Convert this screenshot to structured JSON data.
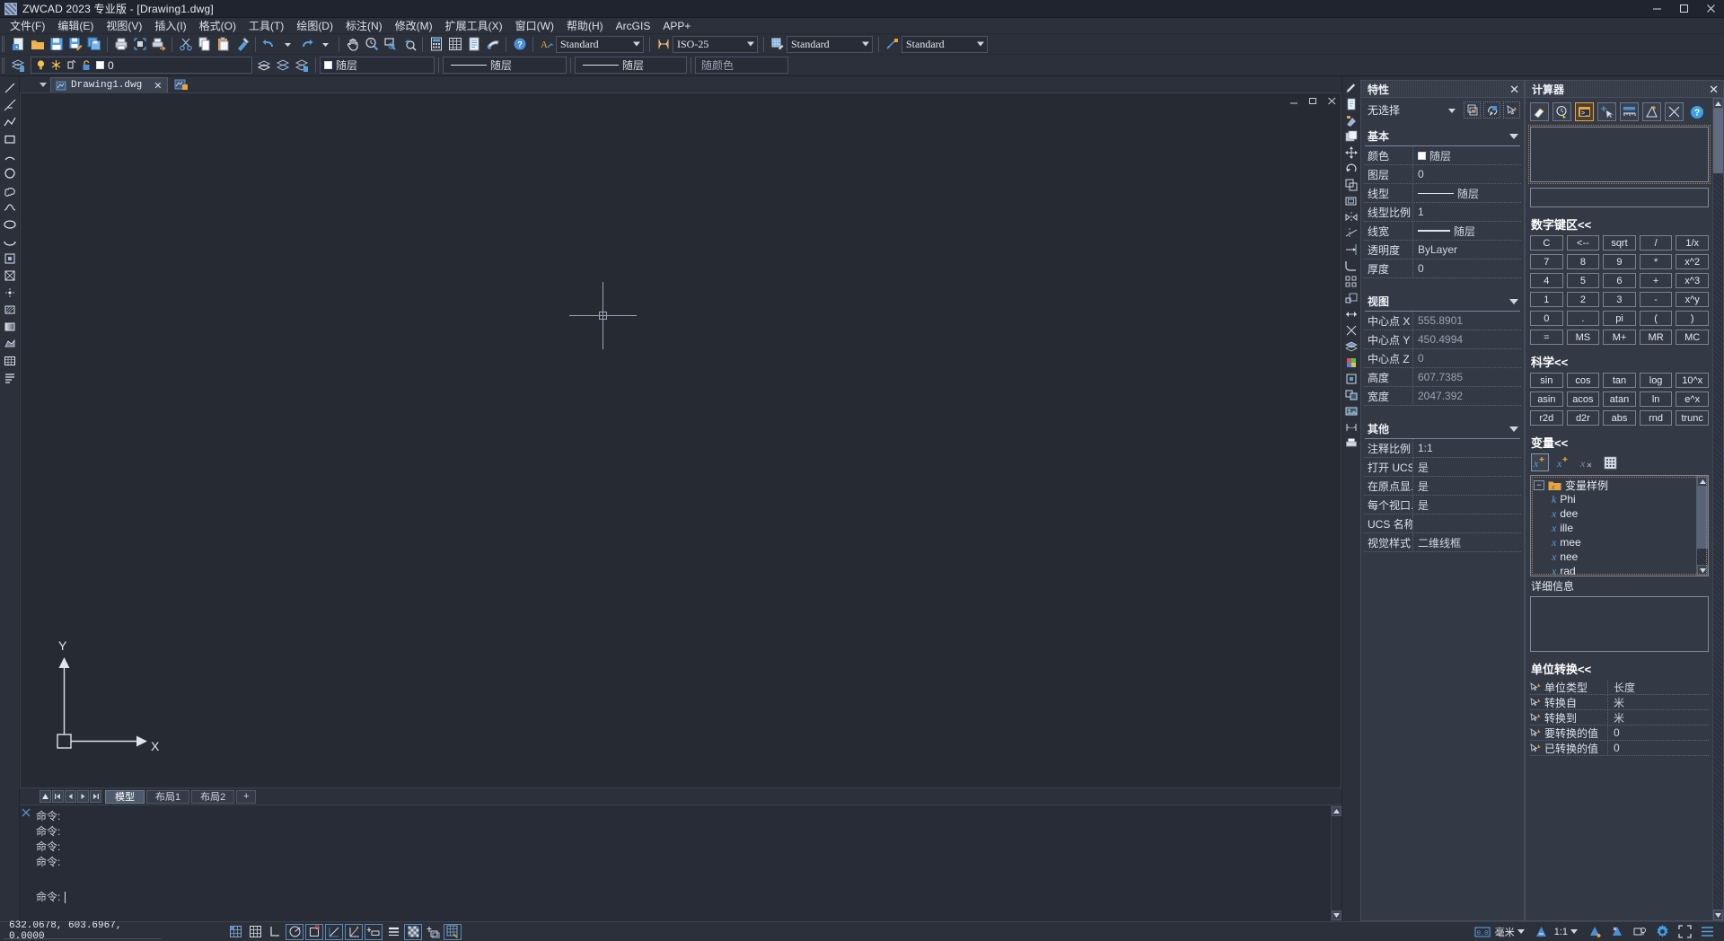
{
  "window": {
    "title": "ZWCAD 2023 专业版 - [Drawing1.dwg]",
    "minimize": "–",
    "maximize": "❐",
    "close": "✕"
  },
  "menu": {
    "items": [
      {
        "label": "文件(F)"
      },
      {
        "label": "编辑(E)"
      },
      {
        "label": "视图(V)"
      },
      {
        "label": "插入(I)"
      },
      {
        "label": "格式(O)"
      },
      {
        "label": "工具(T)"
      },
      {
        "label": "绘图(D)"
      },
      {
        "label": "标注(N)"
      },
      {
        "label": "修改(M)"
      },
      {
        "label": "扩展工具(X)"
      },
      {
        "label": "窗口(W)"
      },
      {
        "label": "帮助(H)"
      },
      {
        "label": "ArcGIS"
      },
      {
        "label": "APP+"
      }
    ]
  },
  "toolbar1": {
    "icons": [
      "new-file-icon",
      "open-folder-icon",
      "save-icon",
      "save-as-icon",
      "save-all-icon",
      "plot-icon",
      "plot-preview-icon",
      "publish-icon",
      "cut-icon",
      "copy-icon",
      "paste-icon",
      "match-properties-icon",
      "undo-icon",
      "undo-dropdown-icon",
      "redo-icon",
      "redo-dropdown-icon",
      "pan-icon",
      "zoom-realtime-icon",
      "zoom-window-icon",
      "zoom-previous-icon",
      "calculator-icon",
      "table-icon",
      "properties-icon",
      "design-center-icon",
      "help-icon"
    ],
    "style_combo": {
      "value": "Standard",
      "icon": "text-style-icon"
    },
    "dim_combo": {
      "value": "ISO-25",
      "icon": "dimension-style-icon"
    },
    "table_combo": {
      "value": "Standard",
      "icon": "table-style-icon"
    },
    "mleader_combo": {
      "value": "Standard",
      "icon": "multileader-style-icon"
    }
  },
  "toolbar2": {
    "layer_manager_icon": "layer-manager-icon",
    "layer": {
      "name": "0",
      "icons": [
        "layer-on-icon",
        "layer-freeze-icon",
        "layer-lock-ploticon",
        "layer-unlock-icon",
        "layer-color-swatch"
      ]
    },
    "layer_tools": [
      "make-object-layer-current-icon",
      "layer-previous-icon",
      "layer-states-icon"
    ],
    "color_combo": {
      "value": "随层"
    },
    "linetype_combo": {
      "value": "随层"
    },
    "lineweight_combo": {
      "value": "随层"
    },
    "plotstyle_combo": {
      "value": "随颜色"
    }
  },
  "left_toolbar": {
    "icons": [
      "line-icon",
      "construction-line-icon",
      "polyline-icon",
      "rectangle-icon",
      "arc-icon",
      "circle-icon",
      "revcloud-icon",
      "spline-icon",
      "ellipse-icon",
      "ellipse-arc-icon",
      "insert-block-icon",
      "make-block-icon",
      "point-icon",
      "hatch-icon",
      "gradient-icon",
      "region-icon",
      "table2-icon",
      "multiline-text-icon"
    ]
  },
  "document": {
    "tab": {
      "name": "Drawing1.dwg",
      "icon": "dwg-file-icon",
      "close": "✕"
    },
    "add_tab_icon": "new-tab-icon",
    "window_controls": {
      "minimize": "–",
      "restore": "❐",
      "close": "✕"
    },
    "ucs": {
      "x_label": "X",
      "y_label": "Y"
    }
  },
  "layout_tabs": {
    "nav": [
      "first-tab-icon",
      "prev-tab-icon",
      "next-tab-icon",
      "last-tab-icon"
    ],
    "up_icon": "model-layout-toggle-icon",
    "tabs": [
      {
        "label": "模型",
        "active": true
      },
      {
        "label": "布局1",
        "active": false
      },
      {
        "label": "布局2",
        "active": false
      }
    ],
    "add": "+"
  },
  "command_line": {
    "close_icon": "close-command-icon",
    "lines": [
      "命令:",
      "命令:",
      "命令:",
      "命令:"
    ],
    "prompt": "命令:",
    "input_value": ""
  },
  "right_rail": {
    "icons": [
      "pen-icon",
      "properties-rail-icon",
      "tool-palette-icon",
      "sheet-set-icon",
      "move-icon",
      "rotate-icon",
      "copy2-icon",
      "offset-icon",
      "mirror-icon",
      "trim-icon",
      "extend-icon",
      "fillet-icon",
      "array-icon",
      "scale-icon",
      "stretch-icon",
      "explode-icon",
      "layer-rail-icon",
      "color-rail-icon",
      "block-rail-icon",
      "xref-rail-icon",
      "image-rail-icon",
      "dim-rail-icon",
      "plot-rail-icon"
    ]
  },
  "properties_panel": {
    "title": "特性",
    "close": "✕",
    "selection": "无选择",
    "toolbar_icons": [
      "select-objects-icon",
      "quick-select-icon",
      "pick-add-icon"
    ],
    "groups": [
      {
        "title": "基本",
        "rows": [
          {
            "name": "颜色",
            "value": "随层",
            "swatch": true
          },
          {
            "name": "图层",
            "value": "0"
          },
          {
            "name": "线型",
            "value": "随层",
            "line": "linetype"
          },
          {
            "name": "线型比例",
            "value": "1"
          },
          {
            "name": "线宽",
            "value": "随层",
            "line": "lineweight"
          },
          {
            "name": "透明度",
            "value": "ByLayer"
          },
          {
            "name": "厚度",
            "value": "0"
          }
        ]
      },
      {
        "title": "视图",
        "rows": [
          {
            "name": "中心点 X",
            "value": "555.8901",
            "dim": true
          },
          {
            "name": "中心点 Y",
            "value": "450.4994",
            "dim": true
          },
          {
            "name": "中心点 Z",
            "value": "0",
            "dim": true
          },
          {
            "name": "高度",
            "value": "607.7385",
            "dim": true
          },
          {
            "name": "宽度",
            "value": "2047.392",
            "dim": true
          }
        ]
      },
      {
        "title": "其他",
        "rows": [
          {
            "name": "注释比例",
            "value": "1:1"
          },
          {
            "name": "打开 UCS...",
            "value": "是"
          },
          {
            "name": "在原点显...",
            "value": "是"
          },
          {
            "name": "每个视口...",
            "value": "是"
          },
          {
            "name": "UCS 名称",
            "value": ""
          },
          {
            "name": "视觉样式",
            "value": "二维线框"
          }
        ]
      }
    ]
  },
  "calculator_panel": {
    "title": "计算器",
    "close": "✕",
    "toolbar_icons": [
      "clear-icon",
      "clear-history-icon",
      "paste-to-command-icon",
      "get-coordinates-icon",
      "distance-icon",
      "angle-icon",
      "intersection-icon",
      "help-blue-icon"
    ],
    "display_value": "",
    "entry_value": "",
    "numeric": {
      "title": "数字键区<<",
      "keys": [
        "C",
        "<--",
        "sqrt",
        "/",
        "1/x",
        "7",
        "8",
        "9",
        "*",
        "x^2",
        "4",
        "5",
        "6",
        "+",
        "x^3",
        "1",
        "2",
        "3",
        "-",
        "x^y",
        "0",
        ".",
        "pi",
        "(",
        ")",
        "=",
        "MS",
        "M+",
        "MR",
        "MC"
      ]
    },
    "scientific": {
      "title": "科学<<",
      "keys": [
        "sin",
        "cos",
        "tan",
        "log",
        "10^x",
        "asin",
        "acos",
        "atan",
        "ln",
        "e^x",
        "r2d",
        "d2r",
        "abs",
        "rnd",
        "trunc"
      ]
    },
    "variables": {
      "title": "变量<<",
      "tool_icons": [
        "new-variable-icon",
        "new-expression-icon",
        "delete-variable-icon",
        "calculator-grid-icon"
      ],
      "root": {
        "label": "变量样例",
        "icon": "folder-variable-icon",
        "expander": "−"
      },
      "items": [
        {
          "label": "Phi",
          "kind": "k"
        },
        {
          "label": "dee",
          "kind": "x"
        },
        {
          "label": "ille",
          "kind": "x"
        },
        {
          "label": "mee",
          "kind": "x"
        },
        {
          "label": "nee",
          "kind": "x"
        },
        {
          "label": "rad",
          "kind": "x"
        }
      ],
      "detail_title": "详细信息",
      "detail_value": ""
    },
    "units": {
      "title": "单位转换<<",
      "rows": [
        {
          "name": "单位类型",
          "value": "长度"
        },
        {
          "name": "转换自",
          "value": "米"
        },
        {
          "name": "转换到",
          "value": "米"
        },
        {
          "name": "要转换的值",
          "value": "0"
        },
        {
          "name": "已转换的值",
          "value": "0"
        }
      ]
    }
  },
  "status_bar": {
    "coordinates": "632.0678,  603.6967,  0.0000",
    "toggles": [
      {
        "name": "snap-grid-icon",
        "on": false
      },
      {
        "name": "grid-display-icon",
        "on": false
      },
      {
        "name": "ortho-mode-icon",
        "on": false
      },
      {
        "name": "polar-tracking-icon",
        "on": true
      },
      {
        "name": "object-snap-icon",
        "on": true
      },
      {
        "name": "object-snap-tracking-icon",
        "on": true
      },
      {
        "name": "dynamic-ucs-icon",
        "on": true
      },
      {
        "name": "dynamic-input-icon",
        "on": true
      },
      {
        "name": "lineweight-display-icon",
        "on": false
      },
      {
        "name": "transparency-display-icon",
        "on": true
      },
      {
        "name": "quick-properties-icon",
        "on": false
      },
      {
        "name": "selection-cycling-icon",
        "on": true
      }
    ],
    "unit_label": "毫米",
    "unit_icon": "units-icon",
    "scale_label": "1:1",
    "scale_icon": "annotation-scale-icon",
    "right_icons": [
      "annotation-visibility-icon",
      "auto-scale-icon",
      "workspace-icon",
      "settings-gear-icon",
      "fullscreen-icon",
      "menu-lines-icon"
    ]
  }
}
